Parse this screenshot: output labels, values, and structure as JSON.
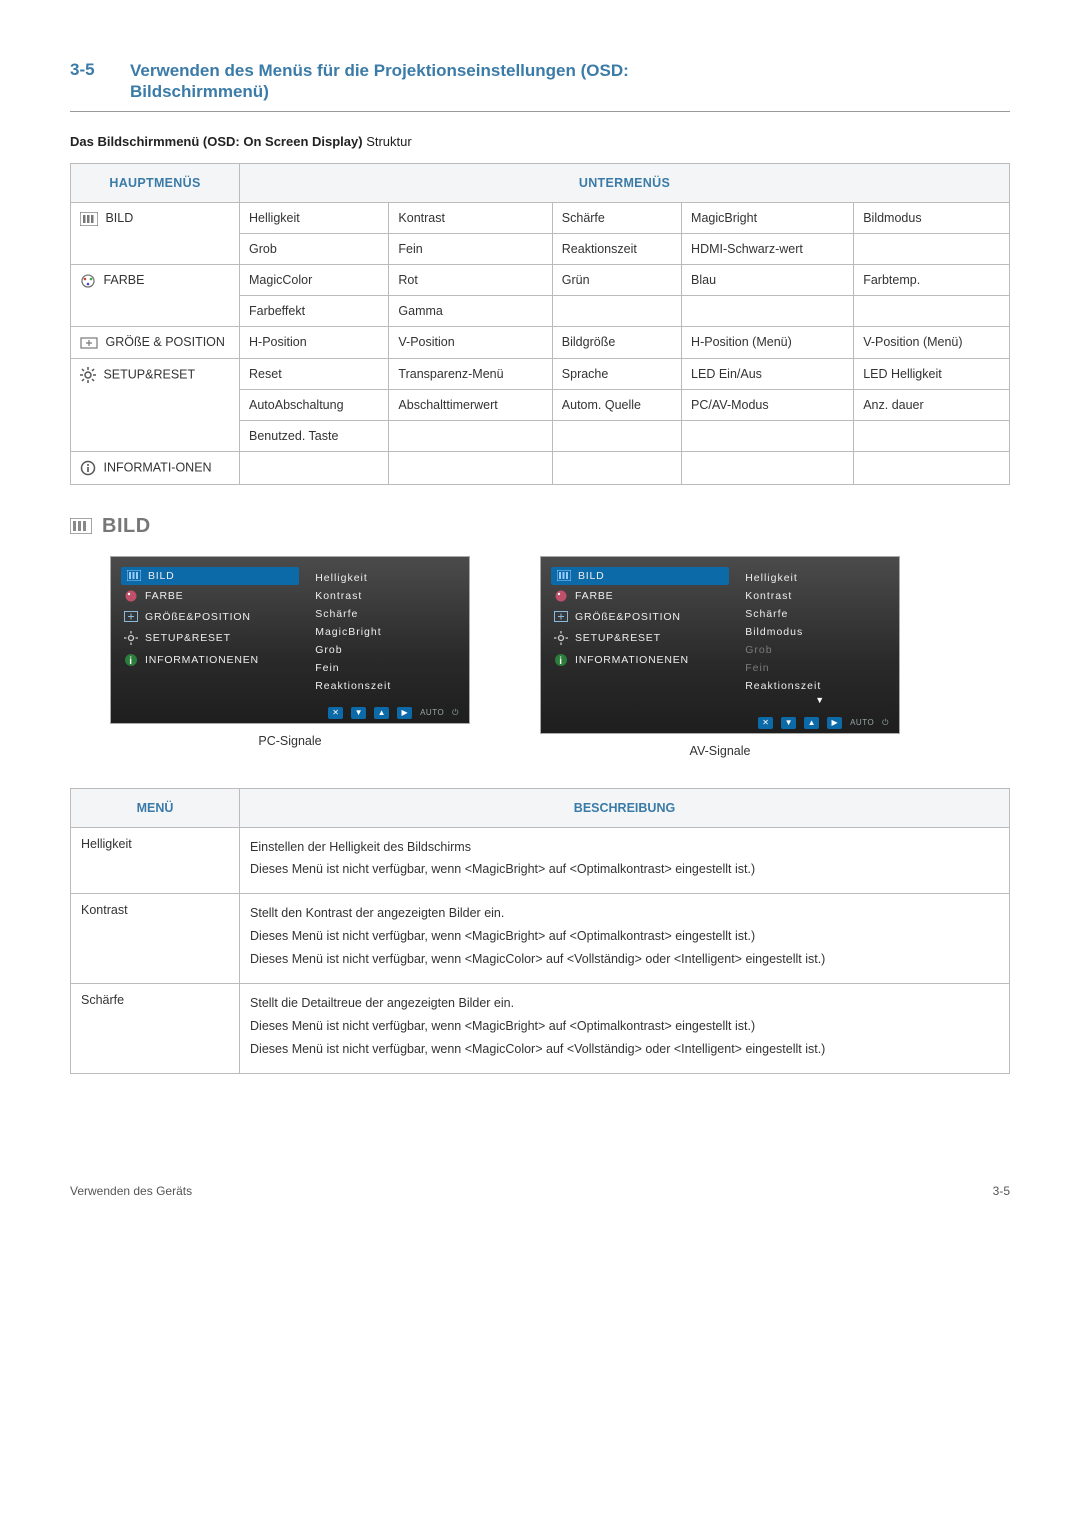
{
  "header": {
    "section_number": "3-5",
    "title_line1": "Verwenden des Menüs für die Projektionseinstellungen (OSD:",
    "title_line2": "Bildschirmmenü)"
  },
  "subheading_bold": "Das Bildschirmmenü (OSD: On Screen Display)",
  "subheading_rest": " Struktur",
  "grid": {
    "head_main": "HAUPTMENÜS",
    "head_sub": "UNTERMENÜS",
    "rows": [
      {
        "main": "BILD",
        "icon": "picture-icon",
        "subs": [
          [
            "Helligkeit",
            "Kontrast",
            "Schärfe",
            "MagicBright",
            "Bildmodus"
          ],
          [
            "Grob",
            "Fein",
            "Reaktionszeit",
            "HDMI-Schwarz-wert",
            ""
          ]
        ]
      },
      {
        "main": "FARBE",
        "icon": "color-icon",
        "subs": [
          [
            "MagicColor",
            "Rot",
            "Grün",
            "Blau",
            "Farbtemp."
          ],
          [
            "Farbeffekt",
            "Gamma",
            "",
            "",
            ""
          ]
        ]
      },
      {
        "main": "GRÖßE & POSITION",
        "icon": "size-icon",
        "subs": [
          [
            "H-Position",
            "V-Position",
            "Bildgröße",
            "H-Position (Menü)",
            "V-Position (Menü)"
          ]
        ]
      },
      {
        "main": "SETUP&RESET",
        "icon": "gear-icon",
        "subs": [
          [
            "Reset",
            "Transparenz-Menü",
            "Sprache",
            "LED Ein/Aus",
            "LED Helligkeit"
          ],
          [
            "AutoAbschaltung",
            "Abschalttimerwert",
            "Autom. Quelle",
            "PC/AV-Modus",
            "Anz. dauer"
          ],
          [
            "Benutzed. Taste",
            "",
            "",
            "",
            ""
          ]
        ]
      },
      {
        "main": "INFORMATI-ONEN",
        "icon": "info-icon",
        "subs": [
          [
            "",
            "",
            "",
            "",
            ""
          ]
        ]
      }
    ]
  },
  "bild_section_title": "BILD",
  "osd": {
    "left_menu": [
      "BILD",
      "FARBE",
      "GRÖßE&POSITION",
      "SETUP&RESET",
      "INFORMATIONENEN"
    ],
    "pc_sub": [
      "Helligkeit",
      "Kontrast",
      "Schärfe",
      "MagicBright",
      "Grob",
      "Fein",
      "Reaktionszeit"
    ],
    "av_sub": [
      {
        "t": "Helligkeit",
        "dim": false
      },
      {
        "t": "Kontrast",
        "dim": false
      },
      {
        "t": "Schärfe",
        "dim": false
      },
      {
        "t": "Bildmodus",
        "dim": false
      },
      {
        "t": "Grob",
        "dim": true
      },
      {
        "t": "Fein",
        "dim": true
      },
      {
        "t": "Reaktionszeit",
        "dim": false
      }
    ],
    "footer_auto": "AUTO",
    "caption_pc": "PC-Signale",
    "caption_av": "AV-Signale"
  },
  "desc": {
    "head_menu": "MENÜ",
    "head_beschr": "BESCHREIBUNG",
    "rows": [
      {
        "name": "Helligkeit",
        "paras": [
          "Einstellen der Helligkeit des Bildschirms",
          "Dieses Menü ist nicht verfügbar, wenn <MagicBright> auf <Optimalkontrast> eingestellt ist.)"
        ]
      },
      {
        "name": "Kontrast",
        "paras": [
          "Stellt den Kontrast der angezeigten Bilder ein.",
          "Dieses Menü ist nicht verfügbar, wenn <MagicBright> auf <Optimalkontrast> eingestellt ist.)",
          "Dieses Menü ist nicht verfügbar, wenn <MagicColor> auf <Vollständig> oder <Intelligent> eingestellt ist.)"
        ]
      },
      {
        "name": "Schärfe",
        "paras": [
          "Stellt die Detailtreue der angezeigten Bilder ein.",
          "Dieses Menü ist nicht verfügbar, wenn <MagicBright> auf <Optimalkontrast> eingestellt ist.)",
          "Dieses Menü ist nicht verfügbar, wenn <MagicColor> auf <Vollständig> oder <Intelligent> eingestellt ist.)"
        ]
      }
    ]
  },
  "footer": {
    "left": "Verwenden des Geräts",
    "right": "3-5"
  }
}
